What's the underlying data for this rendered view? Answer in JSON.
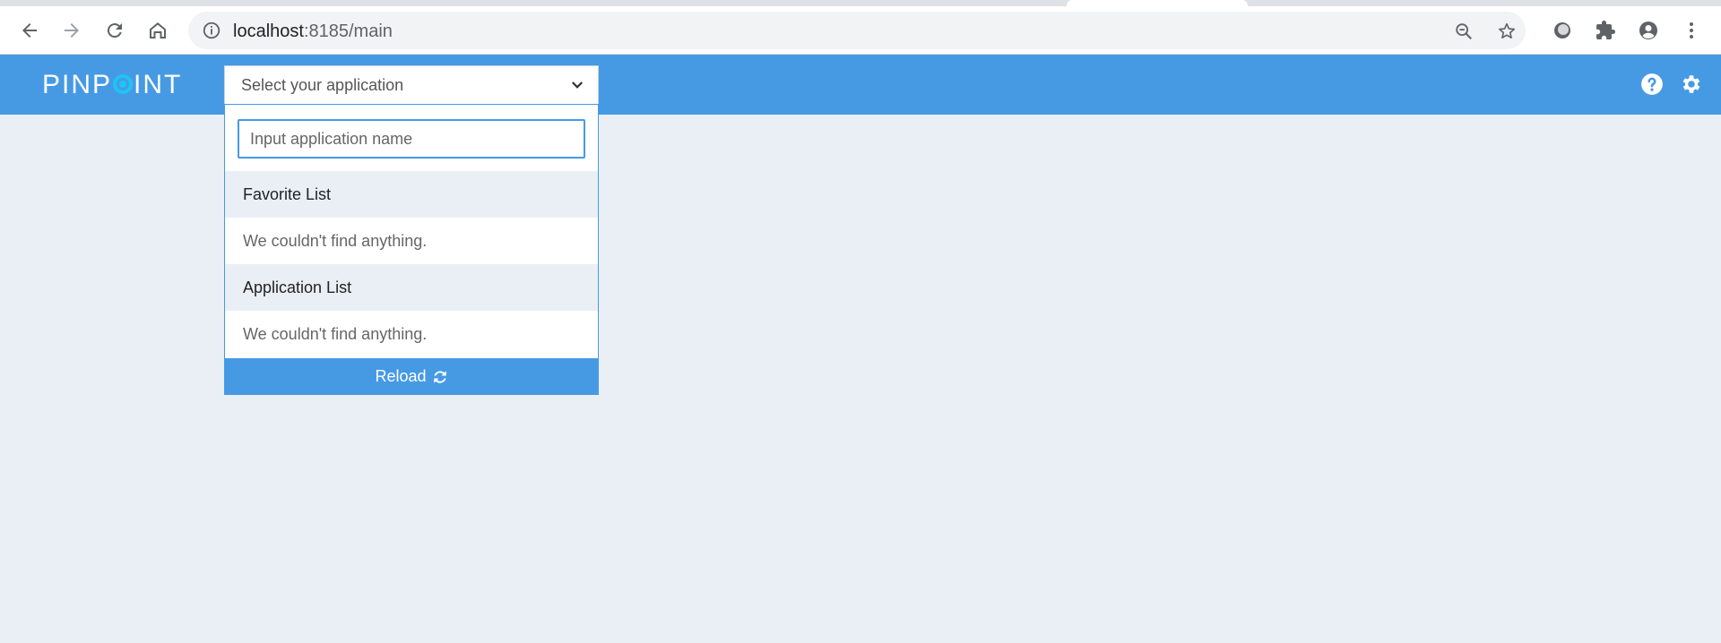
{
  "browser": {
    "url_host": "localhost",
    "url_rest": ":8185/main"
  },
  "header": {
    "logo_left": "PINP",
    "logo_right": "INT",
    "select_placeholder": "Select your application"
  },
  "dropdown": {
    "search_placeholder": "Input application name",
    "favorite_title": "Favorite List",
    "favorite_empty": "We couldn't find anything.",
    "application_title": "Application List",
    "application_empty": "We couldn't find anything.",
    "reload_label": "Reload"
  },
  "colors": {
    "header_bg": "#469ae4",
    "accent": "#1fc4f4",
    "page_bg": "#eaeff6"
  }
}
